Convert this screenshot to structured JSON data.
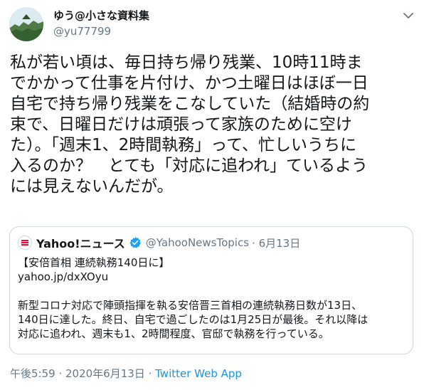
{
  "author": {
    "display_name": "ゆう@小さな資料集",
    "handle": "@yu77799"
  },
  "tweet": {
    "text": "私が若い頃は、毎日持ち帰り残業、10時11時ま\nでかかって仕事を片付け、かつ土曜日はほぼ一日\n自宅で持ち帰り残業をこなしていた（結婚時の約\n束で、日曜日だけは頑張って家族のために空け\nた）。「週末1、2時間執務」って、忙しいうちに\n入るのか？　とても「対応に追われ」ているよう\nには見えないんだが。"
  },
  "quote": {
    "name": "Yahoo!ニュース",
    "handle": "@YahooNewsTopics",
    "date": "· 6月13日",
    "body": "【安倍首相 連続執務140日に】\nyahoo.jp/dxXOyu\n\n新型コロナ対応で陣頭指揮を執る安倍晋三首相の連続執務日数が13日、\n140日に達した。終日、自宅で過ごしたのは1月25日が最後。それ以降は\n対応に追われ、週末も1、2時間程度、官邸で執務を行っている。"
  },
  "meta": {
    "time": "午後5:59",
    "separator": " · ",
    "date": "2020年6月13日",
    "separator2": " · ",
    "app": "Twitter Web App"
  },
  "colors": {
    "text": "#14171a",
    "secondary": "#657786",
    "link": "#1b95e0",
    "verified": "#1da1f2",
    "border": "#ccd6dd"
  },
  "icons": {
    "caret": "chevron-down-icon",
    "verified": "verified-badge-icon",
    "avatar": "user-avatar",
    "quote_avatar": "yahoo-news-avatar"
  }
}
